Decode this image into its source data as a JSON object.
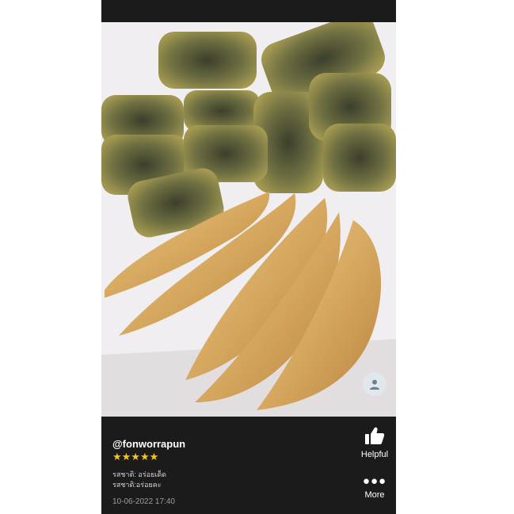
{
  "review": {
    "username": "@fonworrapun",
    "rating_text": "★★★★★",
    "rating": 5,
    "line1": "รสชาติ: อร่อยเด็ด",
    "line2": "รสชาติ:อร่อยคะ",
    "date": "10-06-2022 17:40"
  },
  "actions": {
    "helpful_label": "Helpful",
    "helpful_icon": "thumbs-up-icon",
    "more_label": "More",
    "more_icon": "more-dots-icon"
  },
  "colors": {
    "panel_bg": "#1b1b1b",
    "star": "#f5c518",
    "text": "#ffffff",
    "muted": "#9e9e9e"
  }
}
